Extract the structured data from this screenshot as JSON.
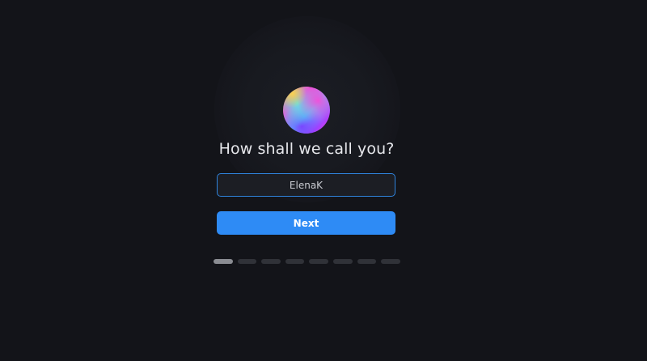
{
  "onboarding": {
    "prompt": "How shall we call you?",
    "name_value": "ElenaK",
    "next_label": "Next",
    "steps": {
      "total": 8,
      "current": 1
    }
  },
  "colors": {
    "background": "#131419",
    "accent": "#2e8bf5",
    "input_border": "#2f83dc",
    "text": "#e6e7eb"
  },
  "icons": {
    "avatar": "gradient-orb-icon"
  }
}
